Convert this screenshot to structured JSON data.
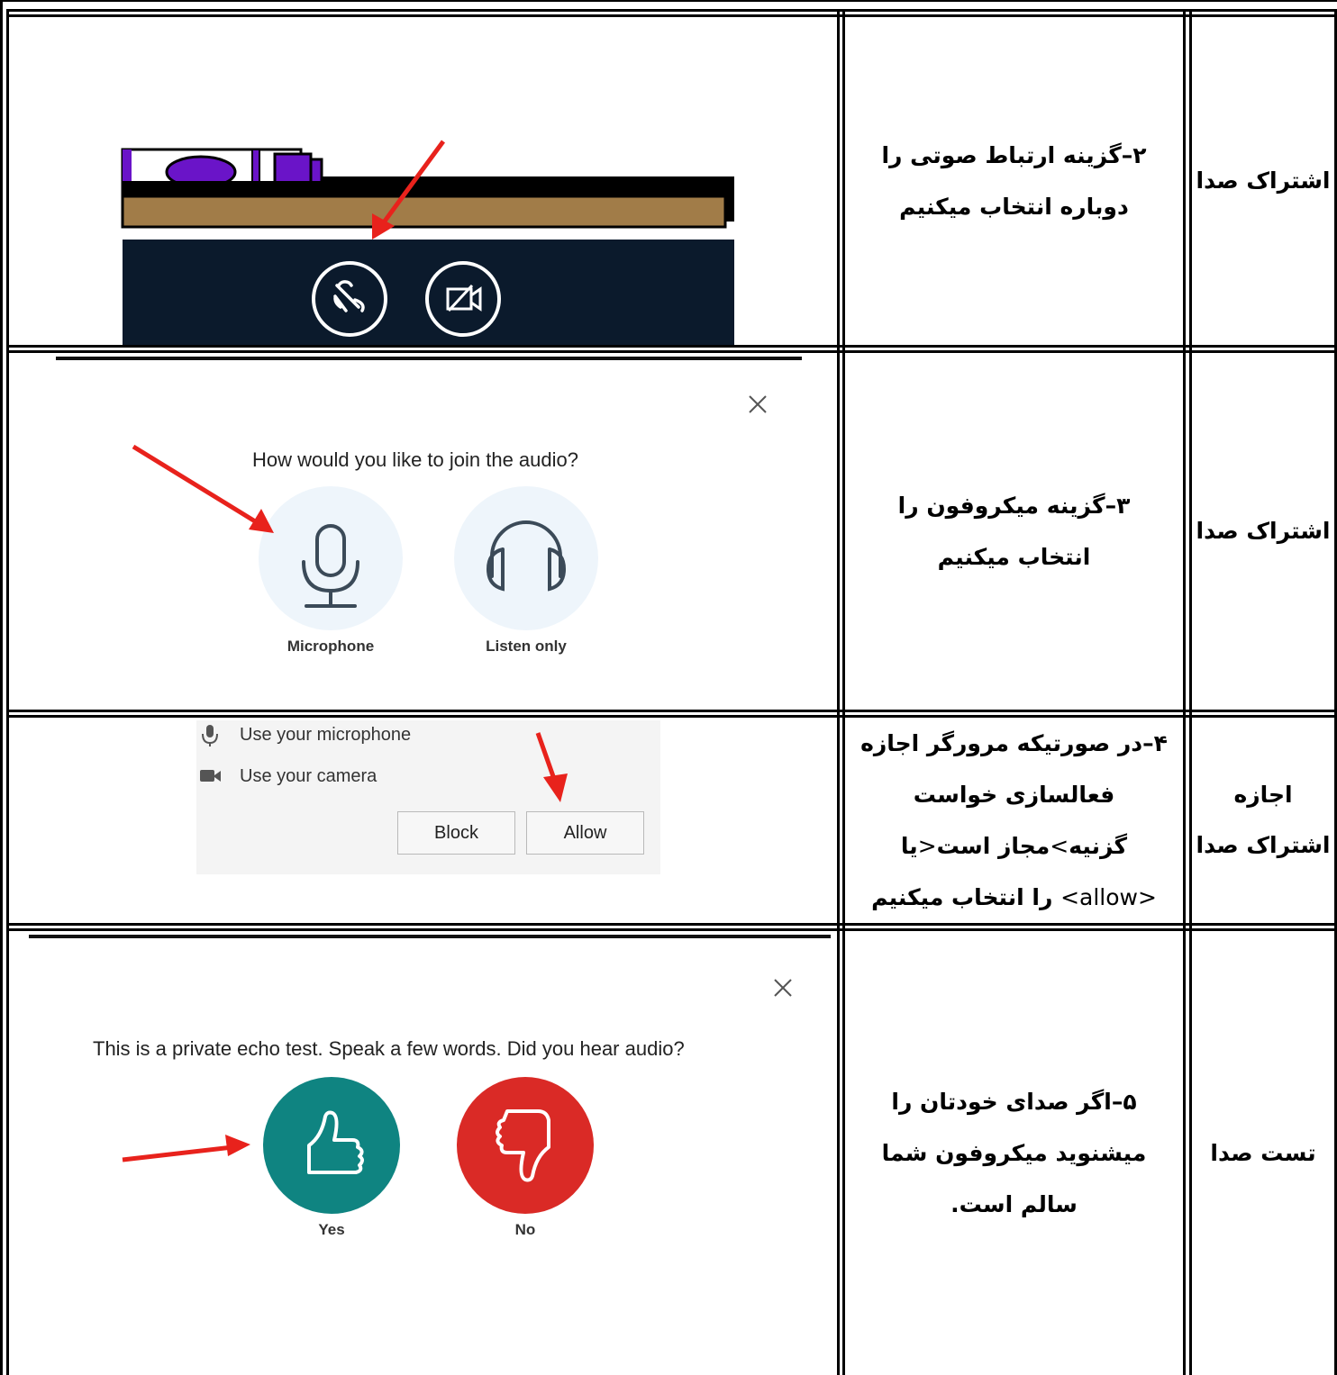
{
  "rows": [
    {
      "label": "اشتراک صدا",
      "description": "۲–گزینه ارتباط صوتی  را دوباره انتخاب میکنیم"
    },
    {
      "label": "اشتراک صدا",
      "description": "۳–گزینه میکروفون را انتخاب میکنیم",
      "dialog": {
        "question": "How would you like to join the audio?",
        "option_microphone": "Microphone",
        "option_listen": "Listen only"
      }
    },
    {
      "label_line1": "اجازه",
      "label_line2": "اشتراک صدا",
      "desc_part1": "۴–در صورتیکه مرورگر اجازه فعالسازی خواست گزنیه",
      "desc_lt1": "<",
      "desc_part2": "مجاز است",
      "desc_gt1": ">",
      "desc_part3": "یا ",
      "desc_allow": "<allow>",
      "desc_part4": " را انتخاب میکنیم",
      "prompt": {
        "use_microphone": "Use your microphone",
        "use_camera": "Use your camera",
        "block": "Block",
        "allow": "Allow"
      }
    },
    {
      "label": "تست صدا",
      "description": "۵–اگر صدای خودتان را میشنوید میکروفون شما سالم است.",
      "echo": {
        "question": "This is a private echo test. Speak a few words. Did you hear audio?",
        "yes": "Yes",
        "no": "No"
      }
    }
  ],
  "colors": {
    "arrow": "#e8221c",
    "toolbar_dark": "#0b1a2c",
    "pen_purple": "#6a14c8",
    "shelf_brown": "#a17c48",
    "bubble_light": "#eef5fb",
    "yes_teal": "#0f8481",
    "no_red": "#da2a26"
  }
}
